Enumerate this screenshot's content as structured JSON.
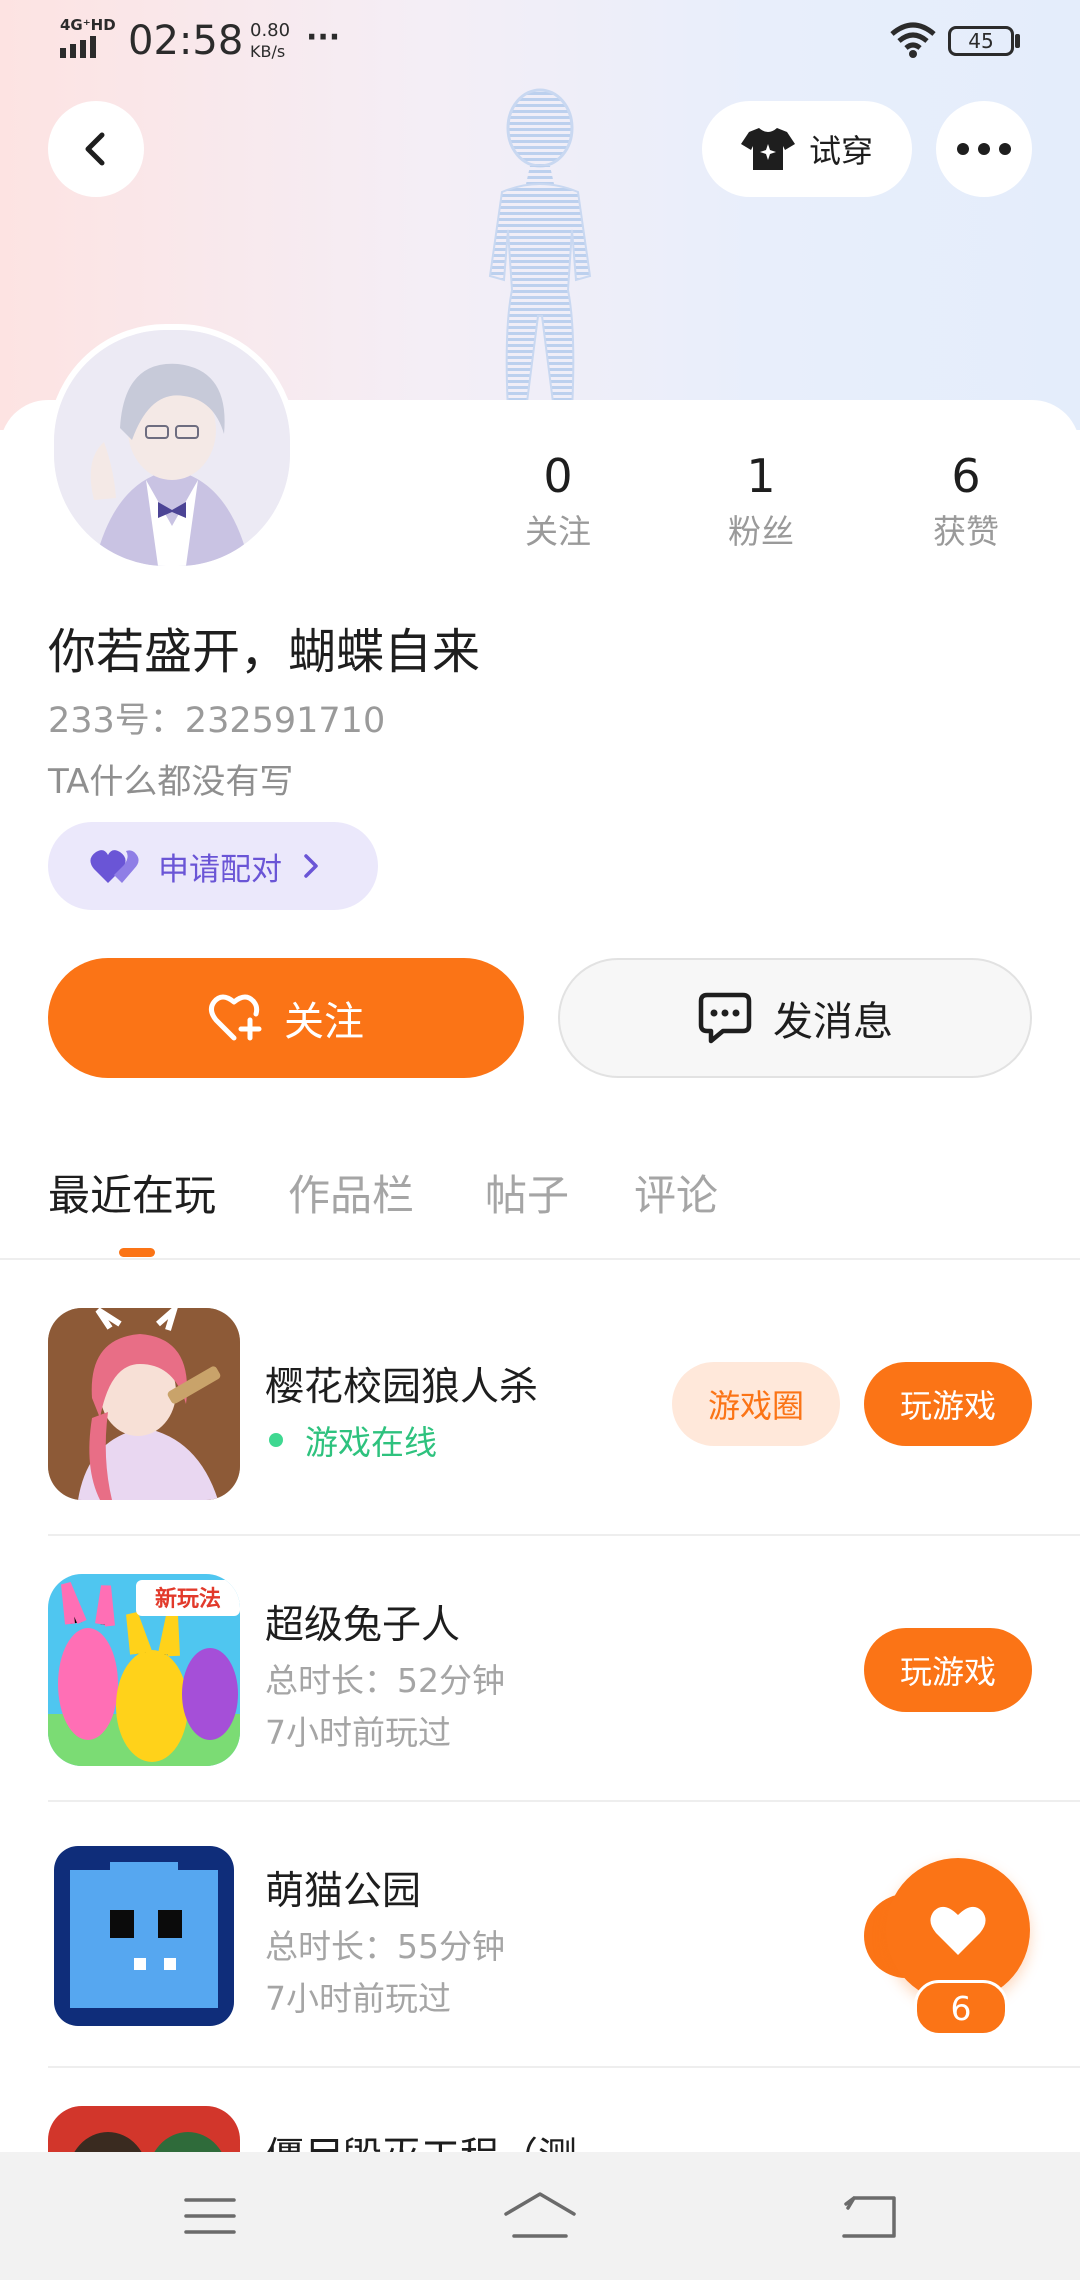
{
  "status_bar": {
    "network": "4G⁺HD",
    "time": "02:58",
    "speed_value": "0.80",
    "speed_unit": "KB/s",
    "more": "···",
    "battery": "45"
  },
  "header": {
    "try_on_label": "试穿"
  },
  "profile": {
    "stats": [
      {
        "value": "0",
        "label": "关注"
      },
      {
        "value": "1",
        "label": "粉丝"
      },
      {
        "value": "6",
        "label": "获赞"
      }
    ],
    "name": "你若盛开，蝴蝶自来",
    "id_text": "233号：232591710",
    "bio": "TA什么都没有写",
    "pair_label": "申请配对"
  },
  "actions": {
    "follow_label": "关注",
    "message_label": "发消息"
  },
  "tabs": [
    {
      "label": "最近在玩",
      "active": true
    },
    {
      "label": "作品栏",
      "active": false
    },
    {
      "label": "帖子",
      "active": false
    },
    {
      "label": "评论",
      "active": false
    }
  ],
  "games": [
    {
      "title": "樱花校园狼人杀",
      "status": "游戏在线",
      "circle_label": "游戏圈",
      "play_label": "玩游戏"
    },
    {
      "title": "超级兔子人",
      "duration": "总时长：52分钟",
      "last_played": "7小时前玩过",
      "play_label": "玩游戏",
      "badge": "新玩法"
    },
    {
      "title": "萌猫公园",
      "duration": "总时长：55分钟",
      "last_played": "7小时前玩过"
    },
    {
      "title": "僵尸毁灭工程（测…"
    }
  ],
  "like": {
    "count": "6"
  },
  "colors": {
    "accent": "#fb7416",
    "pair_purple": "#6a55d6",
    "online_green": "#2ec27e"
  }
}
